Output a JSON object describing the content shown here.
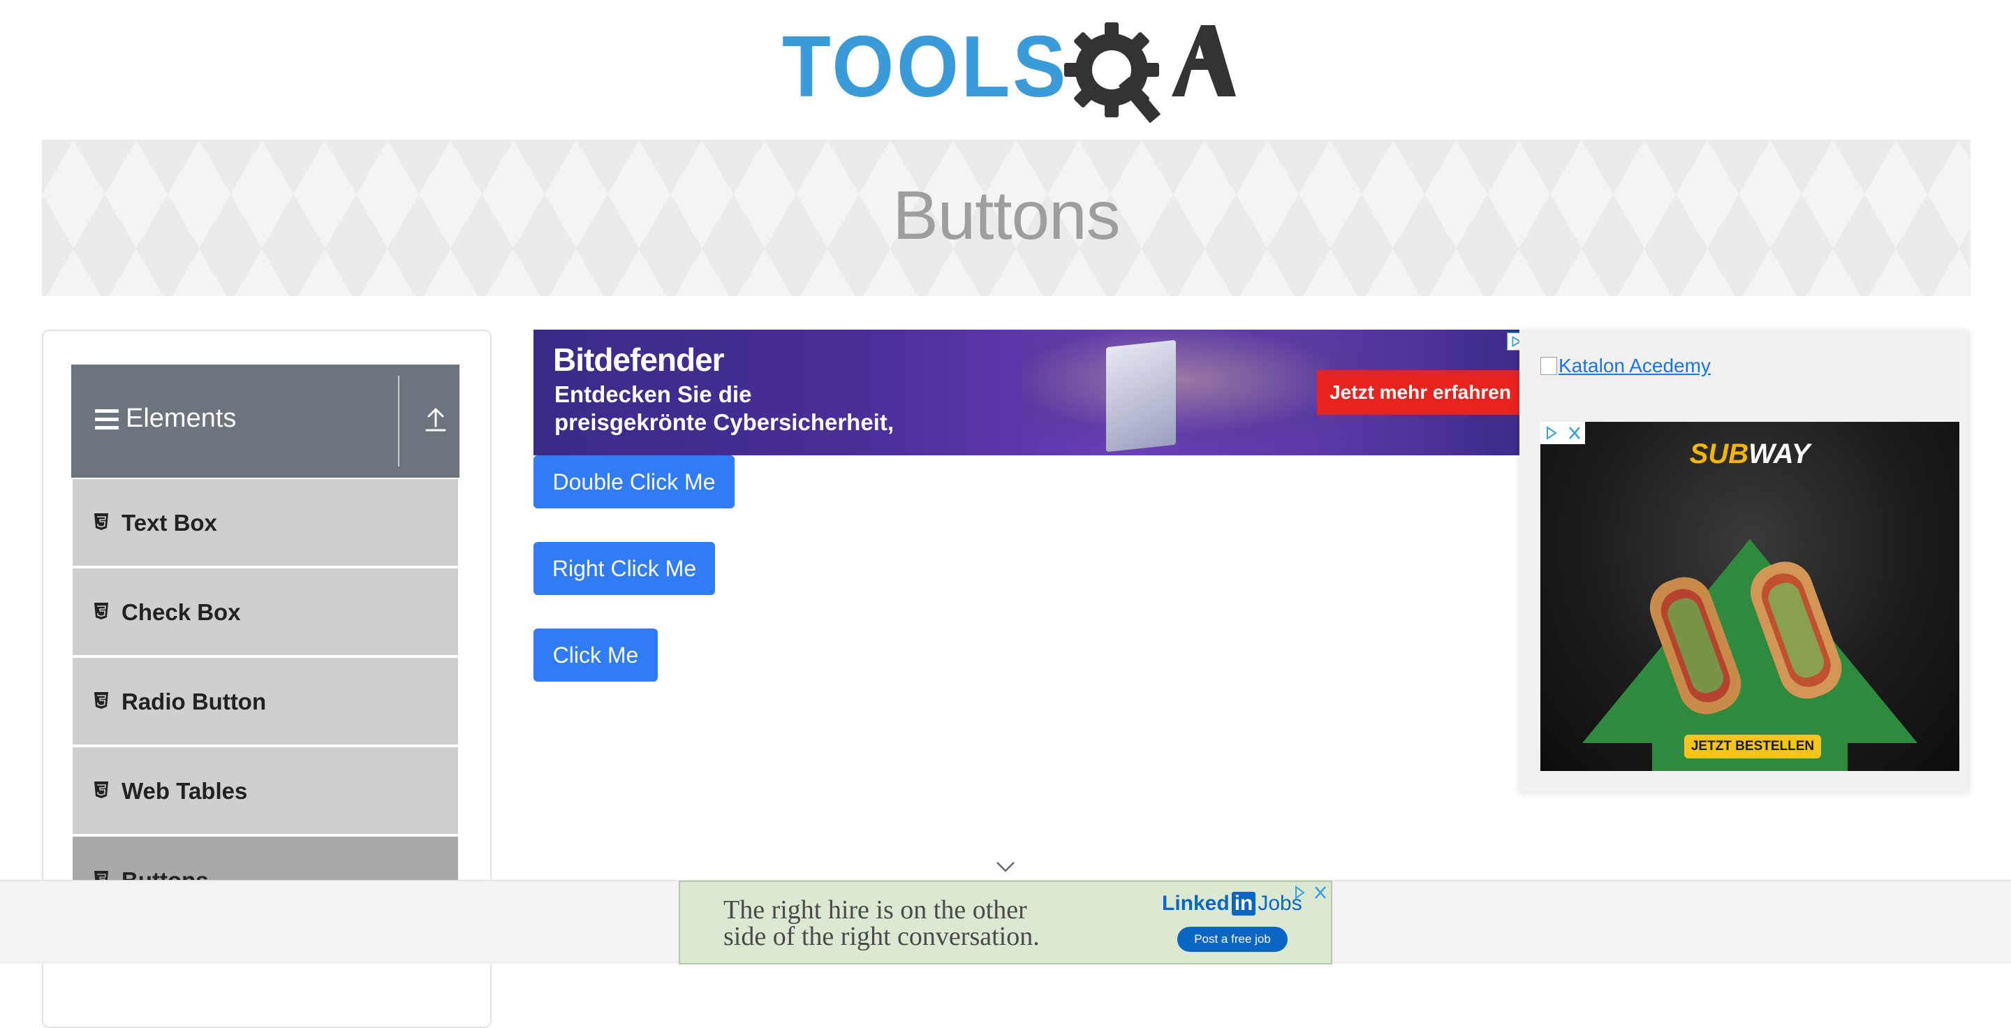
{
  "header": {
    "logo_text": "TOOLSQA",
    "logo_icon": "gear-magnifier-icon"
  },
  "banner": {
    "title": "Buttons"
  },
  "sidebar": {
    "group": {
      "title": "Elements",
      "menu_icon": "hamburger-icon",
      "toggle_icon": "collapse-up-icon"
    },
    "items": [
      {
        "label": "Text Box",
        "icon": "html5-icon"
      },
      {
        "label": "Check Box",
        "icon": "html5-icon"
      },
      {
        "label": "Radio Button",
        "icon": "html5-icon"
      },
      {
        "label": "Web Tables",
        "icon": "html5-icon"
      },
      {
        "label": "Buttons",
        "icon": "html5-icon",
        "active": true
      }
    ]
  },
  "main": {
    "buttons": {
      "double_click": "Double Click Me",
      "right_click": "Right Click Me",
      "click": "Click Me"
    }
  },
  "ads": {
    "top": {
      "brand": "Bitdefender",
      "line1": "Entdecken Sie die",
      "line2": "preisgekrönte Cybersicherheit,",
      "cta": "Jetzt mehr erfahren"
    },
    "right": {
      "katalon_alt": "Katalon Acedemy",
      "subway_brand_a": "SUB",
      "subway_brand_b": "WAY",
      "subway_cta": "JETZT BESTELLEN"
    },
    "bottom": {
      "line1": "The right hire is on the other",
      "line2": "side of the right conversation.",
      "brand_a": "Linked",
      "brand_in": "in",
      "brand_b": "Jobs",
      "cta": "Post a free job"
    }
  },
  "colors": {
    "primary_button": "#2f7cf6",
    "sidebar_header": "#6c757d",
    "sidebar_item": "#cfcfcf",
    "sidebar_item_active": "#a9a9a9",
    "logo_blue": "#3b9ad9",
    "logo_dark": "#333333"
  }
}
